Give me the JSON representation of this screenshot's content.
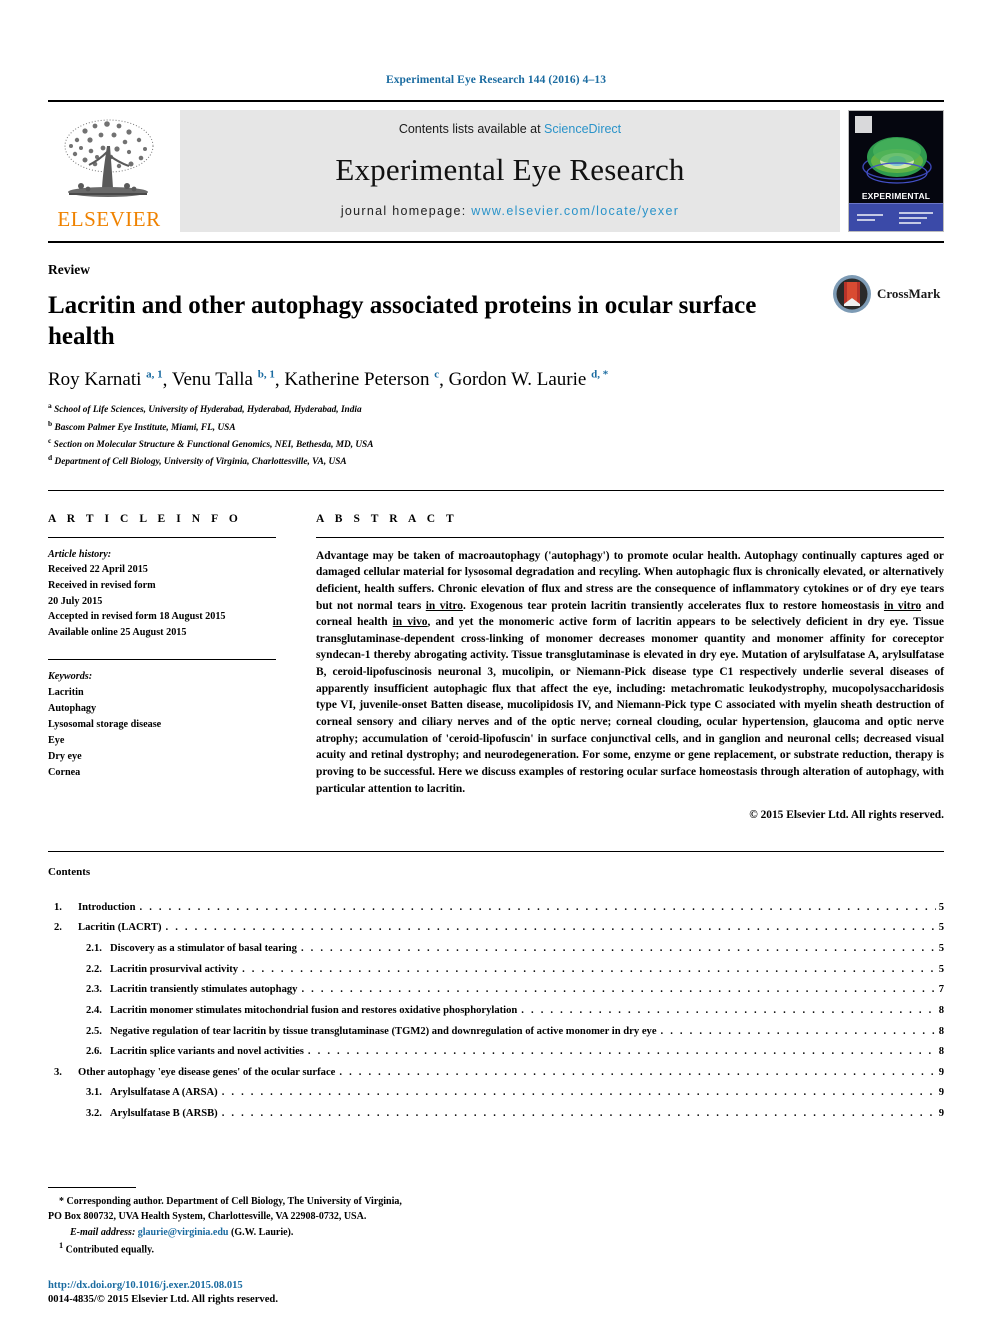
{
  "running_head": "Experimental Eye Research 144 (2016) 4–13",
  "banner": {
    "publisher_name": "ELSEVIER",
    "contents_prefix": "Contents lists available at ",
    "sciencedirect": "ScienceDirect",
    "journal_name": "Experimental Eye Research",
    "homepage_prefix": "journal homepage: ",
    "homepage_url": "www.elsevier.com/locate/yexer",
    "cover_title_line1": "EXPERIMENTAL",
    "cover_title_line2": "EYE RESEARCH"
  },
  "article": {
    "category": "Review",
    "title": "Lacritin and other autophagy associated proteins in ocular surface health",
    "crossmark_label": "CrossMark",
    "authors": [
      {
        "name": "Roy Karnati",
        "sup": "a, 1",
        "sep": ", "
      },
      {
        "name": "Venu Talla",
        "sup": "b, 1",
        "sep": ", "
      },
      {
        "name": "Katherine Peterson",
        "sup": "c",
        "sep": ", "
      },
      {
        "name": "Gordon W. Laurie",
        "sup": "d, *",
        "sep": ""
      }
    ],
    "affiliations": [
      {
        "marker": "a",
        "text": "School of Life Sciences, University of Hyderabad, Hyderabad, Hyderabad, India"
      },
      {
        "marker": "b",
        "text": "Bascom Palmer Eye Institute, Miami, FL, USA"
      },
      {
        "marker": "c",
        "text": "Section on Molecular Structure & Functional Genomics, NEI, Bethesda, MD, USA"
      },
      {
        "marker": "d",
        "text": "Department of Cell Biology, University of Virginia, Charlottesville, VA, USA"
      }
    ]
  },
  "article_info": {
    "heading": "A R T I C L E  I N F O",
    "history_label": "Article history:",
    "history": [
      "Received 22 April 2015",
      "Received in revised form",
      "20 July 2015",
      "Accepted in revised form 18 August 2015",
      "Available online 25 August 2015"
    ],
    "keywords_label": "Keywords:",
    "keywords": [
      "Lacritin",
      "Autophagy",
      "Lysosomal storage disease",
      "Eye",
      "Dry eye",
      "Cornea"
    ]
  },
  "abstract": {
    "heading": "A B S T R A C T",
    "part1": "Advantage may be taken of macroautophagy ('autophagy') to promote ocular health. Autophagy continually captures aged or damaged cellular material for lysosomal degradation and recyling. When autophagic flux is chronically elevated, or alternatively deficient, health suffers. Chronic elevation of flux and stress are the consequence of inflammatory cytokines or of dry eye tears but not normal tears ",
    "italic1": "in vitro",
    "part2": ". Exogenous tear protein lacritin transiently accelerates flux to restore homeostasis ",
    "italic2": "in vitro",
    "part3": " and corneal health ",
    "italic3": "in vivo",
    "part4": ", and yet the monomeric active form of lacritin appears to be selectively deficient in dry eye. Tissue transglutaminase-dependent cross-linking of monomer decreases monomer quantity and monomer affinity for coreceptor syndecan-1 thereby abrogating activity. Tissue transglutaminase is elevated in dry eye. Mutation of arylsulfatase A, arylsulfatase B, ceroid-lipofuscinosis neuronal 3, mucolipin, or Niemann-Pick disease type C1 respectively underlie several diseases of apparently insufficient autophagic flux that affect the eye, including: metachromatic leukodystrophy, mucopolysaccharidosis type VI, juvenile-onset Batten disease, mucolipidosis IV, and Niemann-Pick type C associated with myelin sheath destruction of corneal sensory and ciliary nerves and of the optic nerve; corneal clouding, ocular hypertension, glaucoma and optic nerve atrophy; accumulation of 'ceroid-lipofuscin' in surface conjunctival cells, and in ganglion and neuronal cells; decreased visual acuity and retinal dystrophy; and neurodegeneration. For some, enzyme or gene replacement, or substrate reduction, therapy is proving to be successful. Here we discuss examples of restoring ocular surface homeostasis through alteration of autophagy, with particular attention to lacritin.",
    "copyright": "© 2015 Elsevier Ltd. All rights reserved."
  },
  "contents": {
    "heading": "Contents",
    "items": [
      {
        "num": "1.",
        "label": "Introduction",
        "page": "5",
        "level": 1
      },
      {
        "num": "2.",
        "label": "Lacritin (LACRT)",
        "page": "5",
        "level": 1
      },
      {
        "num": "2.1.",
        "label": "Discovery as a stimulator of basal tearing",
        "page": "5",
        "level": 2
      },
      {
        "num": "2.2.",
        "label": "Lacritin prosurvival activity",
        "page": "5",
        "level": 2
      },
      {
        "num": "2.3.",
        "label": "Lacritin transiently stimulates autophagy",
        "page": "7",
        "level": 2
      },
      {
        "num": "2.4.",
        "label": "Lacritin monomer stimulates mitochondrial fusion and restores oxidative phosphorylation",
        "page": "8",
        "level": 2
      },
      {
        "num": "2.5.",
        "label": "Negative regulation of tear lacritin by tissue transglutaminase (TGM2) and downregulation of active monomer in dry eye",
        "page": "8",
        "level": 2
      },
      {
        "num": "2.6.",
        "label": "Lacritin splice variants and novel activities",
        "page": "8",
        "level": 2
      },
      {
        "num": "3.",
        "label": "Other autophagy 'eye disease genes' of the ocular surface",
        "page": "9",
        "level": 1
      },
      {
        "num": "3.1.",
        "label": "Arylsulfatase A (ARSA)",
        "page": "9",
        "level": 2
      },
      {
        "num": "3.2.",
        "label": "Arylsulfatase B (ARSB)",
        "page": "9",
        "level": 2
      }
    ]
  },
  "footnotes": {
    "corresponding_marker": "*",
    "corresponding_line1": "Corresponding author. Department of Cell Biology, The University of Virginia,",
    "corresponding_line2": "PO Box 800732, UVA Health System, Charlottesville, VA 22908-0732, USA.",
    "email_label": "E-mail address:",
    "email": "glaurie@virginia.edu",
    "email_owner": "(G.W. Laurie).",
    "contrib_marker": "1",
    "contrib_text": "Contributed equally.",
    "doi": "http://dx.doi.org/10.1016/j.exer.2015.08.015",
    "issn": "0014-4835/© 2015 Elsevier Ltd. All rights reserved."
  },
  "colors": {
    "link_blue": "#1a6ba0",
    "sciencedirect_blue": "#2a93c9",
    "elsevier_orange": "#ef8200",
    "banner_gray": "#e6e6e6"
  }
}
